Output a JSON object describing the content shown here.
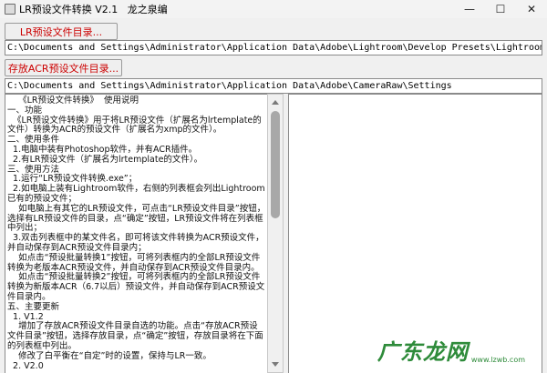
{
  "window": {
    "title": "LR预设文件转换 V2.1   龙之泉编",
    "minimize_glyph": "—",
    "maximize_glyph": "☐",
    "close_glyph": "✕"
  },
  "lr": {
    "button_label": "LR预设文件目录...",
    "path": "C:\\Documents and Settings\\Administrator\\Application Data\\Adobe\\Lightroom\\Develop Presets\\Lightroom 预设"
  },
  "acr": {
    "button_label": "存放ACR预设文件目录...",
    "path": "C:\\Documents and Settings\\Administrator\\Application Data\\Adobe\\CameraRaw\\Settings"
  },
  "readme": {
    "text": "    《LR预设文件转换》  使用说明\n一、功能\n  《LR预设文件转换》用于将LR预设文件（扩展名为lrtemplate的文件）转换为ACR的预设文件（扩展名为xmp的文件）。\n二、使用条件\n  1.电脑中装有Photoshop软件，并有ACR插件。\n  2.有LR预设文件（扩展名为lrtemplate的文件）。\n三、使用方法\n  1.运行“LR预设文件转换.exe”；\n  2.如电脑上装有Lightroom软件，右侧的列表框会列出Lightroom已有的预设文件；\n    如电脑上有其它的LR预设文件，可点击“LR预设文件目录”按钮，选择有LR预设文件的目录，点“确定”按钮，LR预设文件将在列表框中列出；\n  3.双击列表框中的某文件名，即可将该文件转换为ACR预设文件，并自动保存到ACR预设文件目录内；\n    如点击“预设批量转换1”按钮，可将列表框内的全部LR预设文件转换为老版本ACR预设文件，并自动保存到ACR预设文件目录内。\n    如点击“预设批量转换2”按钮，可将列表框内的全部LR预设文件转换为新版本ACR（6.7以后）预设文件，并自动保存到ACR预设文件目录内。\n五、主要更新\n  1. V1.2\n    增加了存放ACR预设文件目录自选的功能。点击“存放ACR预设文件目录”按钮，选择存放目录，点“确定”按钮，存放目录将在下面的列表框中列出。\n    修改了白平衡在“自定”时的设置，保持与LR一致。\n  2. V2.0"
  },
  "preset_list": {
    "items": []
  },
  "watermark": {
    "text": "广东龙网",
    "url": "www.lzwb.com"
  }
}
